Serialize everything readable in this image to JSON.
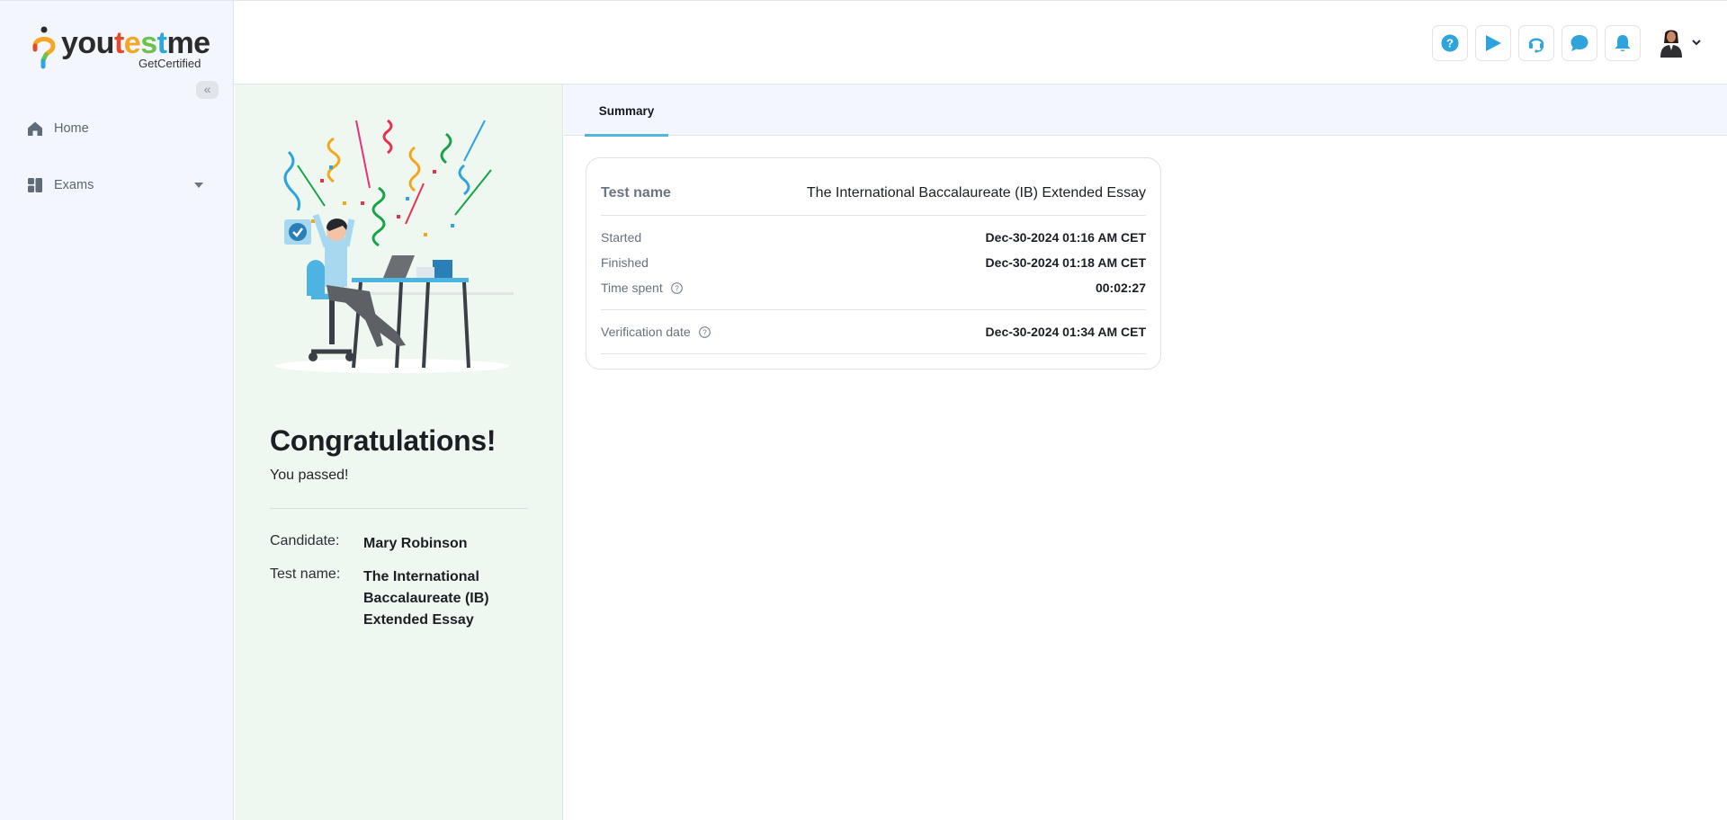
{
  "brand": {
    "logo_parts": [
      "you",
      "t",
      "e",
      "s",
      "t",
      "me"
    ],
    "tagline": "GetCertified"
  },
  "sidebar": {
    "collapse_label": "«",
    "items": [
      {
        "label": "Home",
        "icon": "home-icon"
      },
      {
        "label": "Exams",
        "icon": "dashboard-icon",
        "has_submenu": true
      }
    ]
  },
  "topbar": {
    "buttons": [
      {
        "name": "help",
        "icon": "question-circle-icon"
      },
      {
        "name": "play",
        "icon": "play-icon"
      },
      {
        "name": "support",
        "icon": "headset-icon"
      },
      {
        "name": "chat",
        "icon": "chat-bubble-icon"
      },
      {
        "name": "notifications",
        "icon": "bell-icon"
      }
    ],
    "accent_color": "#2ea3dc"
  },
  "result": {
    "title": "Congratulations!",
    "subtitle": "You passed!",
    "candidate_label": "Candidate:",
    "candidate_value": "Mary Robinson",
    "test_name_label": "Test name:",
    "test_name_value": "The International Baccalaureate (IB) Extended Essay",
    "panel_color": "#eef8f1"
  },
  "tabs": [
    {
      "label": "Summary",
      "active": true
    }
  ],
  "summary": {
    "test_name_label": "Test name",
    "test_name_value": "The International Baccalaureate (IB) Extended Essay",
    "started_label": "Started",
    "started_value": "Dec-30-2024 01:16 AM CET",
    "finished_label": "Finished",
    "finished_value": "Dec-30-2024 01:18 AM CET",
    "time_spent_label": "Time spent",
    "time_spent_value": "00:02:27",
    "verification_label": "Verification date",
    "verification_value": "Dec-30-2024 01:34 AM CET"
  }
}
